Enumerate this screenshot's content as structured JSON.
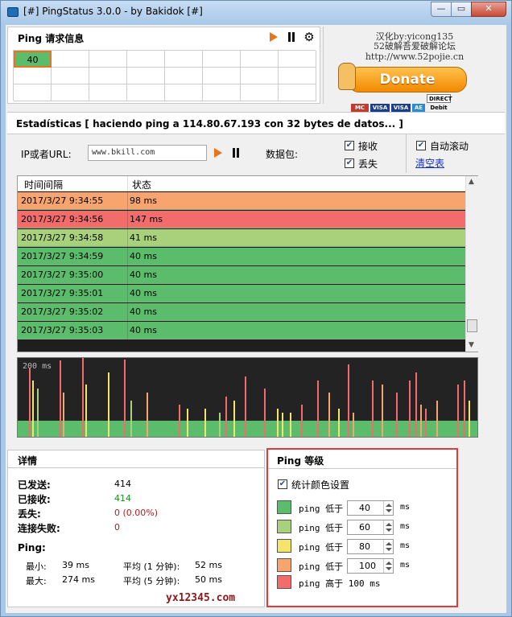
{
  "window": {
    "title": "[#] PingStatus 3.0.0 - by Bakidok [#]"
  },
  "ping_panel": {
    "title": "Ping 请求信息",
    "first_cell": "40"
  },
  "promo": {
    "line1": "汉化by:yicong135",
    "line2": "52破解吾爱破解论坛",
    "line3": "http://www.52pojie.cn",
    "donate_label": "Donate",
    "cards": [
      "MC",
      "VISA",
      "VISA",
      "AE",
      "DIRECT Debit"
    ]
  },
  "stats": {
    "text": "Estadísticas  [ haciendo ping a 114.80.67.193 con 32 bytes de datos... ]"
  },
  "controls": {
    "ip_label": "IP或者URL:",
    "ip_value": "www.bkill.com",
    "packets_label": "数据包:",
    "receive_label": "接收",
    "lost_label": "丢失",
    "autoscroll_label": "自动滚动",
    "clear_label": "清空表"
  },
  "table": {
    "headers": [
      "时间间隔",
      "状态"
    ],
    "rows": [
      {
        "time": "2017/3/27  9:34:55",
        "status": "98 ms",
        "color": "#f7a46e"
      },
      {
        "time": "2017/3/27  9:34:56",
        "status": "147 ms",
        "color": "#f26c6c"
      },
      {
        "time": "2017/3/27  9:34:58",
        "status": "41 ms",
        "color": "#a9d07a"
      },
      {
        "time": "2017/3/27  9:34:59",
        "status": "40 ms",
        "color": "#5bbd6b"
      },
      {
        "time": "2017/3/27  9:35:00",
        "status": "40 ms",
        "color": "#5bbd6b"
      },
      {
        "time": "2017/3/27  9:35:01",
        "status": "40 ms",
        "color": "#5bbd6b"
      },
      {
        "time": "2017/3/27  9:35:02",
        "status": "40 ms",
        "color": "#5bbd6b"
      },
      {
        "time": "2017/3/27  9:35:03",
        "status": "40 ms",
        "color": "#5bbd6b"
      }
    ]
  },
  "graph": {
    "label": "200 ms"
  },
  "details": {
    "title": "详情",
    "sent_label": "已发送:",
    "sent_value": "414",
    "received_label": "已接收:",
    "received_value": "414",
    "lost_label": "丢失:",
    "lost_value": "0 (0.00%)",
    "fail_label": "连接失败:",
    "fail_value": "0",
    "ping_label": "Ping:",
    "min_label": "最小:",
    "min_value": "39 ms",
    "max_label": "最大:",
    "max_value": "274 ms",
    "avg1_label": "平均 (1 分钟):",
    "avg1_value": "52 ms",
    "avg5_label": "平均 (5 分钟):",
    "avg5_value": "50 ms"
  },
  "levels": {
    "title": "Ping 等级",
    "stat_color_label": "统计颜色设置",
    "items": [
      {
        "label": "ping 低于",
        "value": "40",
        "unit": "ms",
        "color": "#5bbd6b"
      },
      {
        "label": "ping 低于",
        "value": "60",
        "unit": "ms",
        "color": "#a9d07a"
      },
      {
        "label": "ping 低于",
        "value": "80",
        "unit": "ms",
        "color": "#f5e46b"
      },
      {
        "label": "ping 低于",
        "value": "100",
        "unit": "ms",
        "color": "#f7a46e"
      }
    ],
    "last_label": "ping 高于 100 ms",
    "last_color": "#f26c6c"
  },
  "watermark": "yx12345.com"
}
